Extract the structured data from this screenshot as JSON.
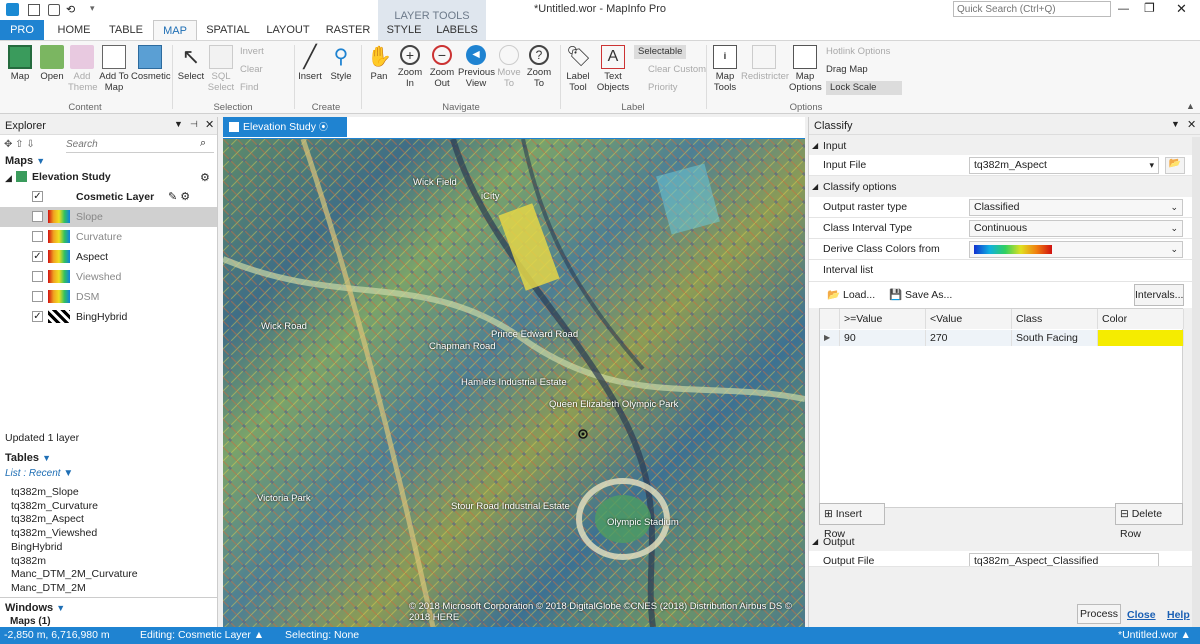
{
  "titlebar": {
    "title": "*Untitled.wor - MapInfo Pro",
    "search_placeholder": "Quick Search (Ctrl+Q)"
  },
  "tabs": {
    "pro": "PRO",
    "home": "HOME",
    "table": "TABLE",
    "map": "MAP",
    "spatial": "SPATIAL",
    "layout": "LAYOUT",
    "raster": "RASTER",
    "layer_tools": "LAYER TOOLS",
    "style": "STYLE",
    "labels": "LABELS"
  },
  "ribbon": {
    "map": "Map",
    "open": "Open",
    "add_theme": "Add Theme",
    "add_to_map": "Add To Map",
    "cosmetic": "Cosmetic",
    "select": "Select",
    "sql_select": "SQL Select",
    "invert": "Invert",
    "clear": "Clear",
    "find": "Find",
    "insert": "Insert",
    "style": "Style",
    "pan": "Pan",
    "zoom_in": "Zoom In",
    "zoom_out": "Zoom Out",
    "previous_view": "Previous View",
    "move_to": "Move To",
    "zoom_to": "Zoom To",
    "label_tool": "Label Tool",
    "text_objects": "Text Objects",
    "selectable": "Selectable",
    "clear_custom": "Clear Custom",
    "priority": "Priority",
    "map_tools": "Map Tools",
    "redistricter": "Redistricter",
    "map_options": "Map Options",
    "hotlink_options": "Hotlink Options",
    "drag_map": "Drag Map",
    "lock_scale": "Lock Scale",
    "groups": {
      "content": "Content",
      "selection": "Selection",
      "create": "Create",
      "navigate": "Navigate",
      "label": "Label",
      "options": "Options"
    }
  },
  "explorer": {
    "title": "Explorer",
    "search_placeholder": "Search",
    "maps_header": "Maps",
    "map_name": "Elevation Study",
    "layers": [
      {
        "name": "Cosmetic Layer",
        "checked": true
      },
      {
        "name": "Slope",
        "checked": false
      },
      {
        "name": "Curvature",
        "checked": false
      },
      {
        "name": "Aspect",
        "checked": true
      },
      {
        "name": "Viewshed",
        "checked": false
      },
      {
        "name": "DSM",
        "checked": false
      },
      {
        "name": "BingHybrid",
        "checked": true
      }
    ],
    "status": "Updated 1 layer",
    "tables_header": "Tables",
    "list_mode": "List : Recent",
    "tables": [
      "tq382m_Slope",
      "tq382m_Curvature",
      "tq382m_Aspect",
      "tq382m_Viewshed",
      "BingHybrid",
      "tq382m",
      "Manc_DTM_2M_Curvature",
      "Manc_DTM_2M"
    ],
    "windows_header": "Windows",
    "maps_count": "Maps  (1)"
  },
  "map_window": {
    "title": "Elevation Study",
    "copyright": "© 2018 Microsoft Corporation © 2018 DigitalGlobe ©CNES (2018) Distribution Airbus DS © 2018 HERE",
    "labels": [
      "Wick Field",
      "iCity",
      "Wick Road",
      "Victoria Park",
      "Queen Elizabeth Olympic Park",
      "Olympic Stadium",
      "Stour Road Industrial Estate",
      "Hamlets Industrial Estate",
      "Prince Edward Road",
      "Chapman Road"
    ]
  },
  "classify": {
    "title": "Classify",
    "input_section": "Input",
    "input_file_label": "Input File",
    "input_file": "tq382m_Aspect",
    "options_section": "Classify options",
    "output_type_label": "Output raster type",
    "output_type": "Classified",
    "interval_type_label": "Class Interval Type",
    "interval_type": "Continuous",
    "derive_label": "Derive Class Colors  from",
    "interval_list": "Interval list",
    "load": "Load...",
    "save_as": "Save As...",
    "intervals": "Intervals...",
    "columns": [
      ">=Value",
      "<Value",
      "Class",
      "Color"
    ],
    "rows": [
      {
        "min": "90",
        "max": "270",
        "class": "South Facing",
        "color": "#f5ec00"
      }
    ],
    "insert_row": "Insert Row",
    "delete_row": "Delete Row",
    "output_section": "Output",
    "output_file_label": "Output File",
    "output_file": "tq382m_Aspect_Classified",
    "process": "Process",
    "close": "Close",
    "help": "Help"
  },
  "statusbar": {
    "coords": "-2,850 m, 6,716,980 m",
    "editing": "Editing: Cosmetic Layer",
    "selecting": "Selecting: None",
    "workspace": "*Untitled.wor"
  }
}
